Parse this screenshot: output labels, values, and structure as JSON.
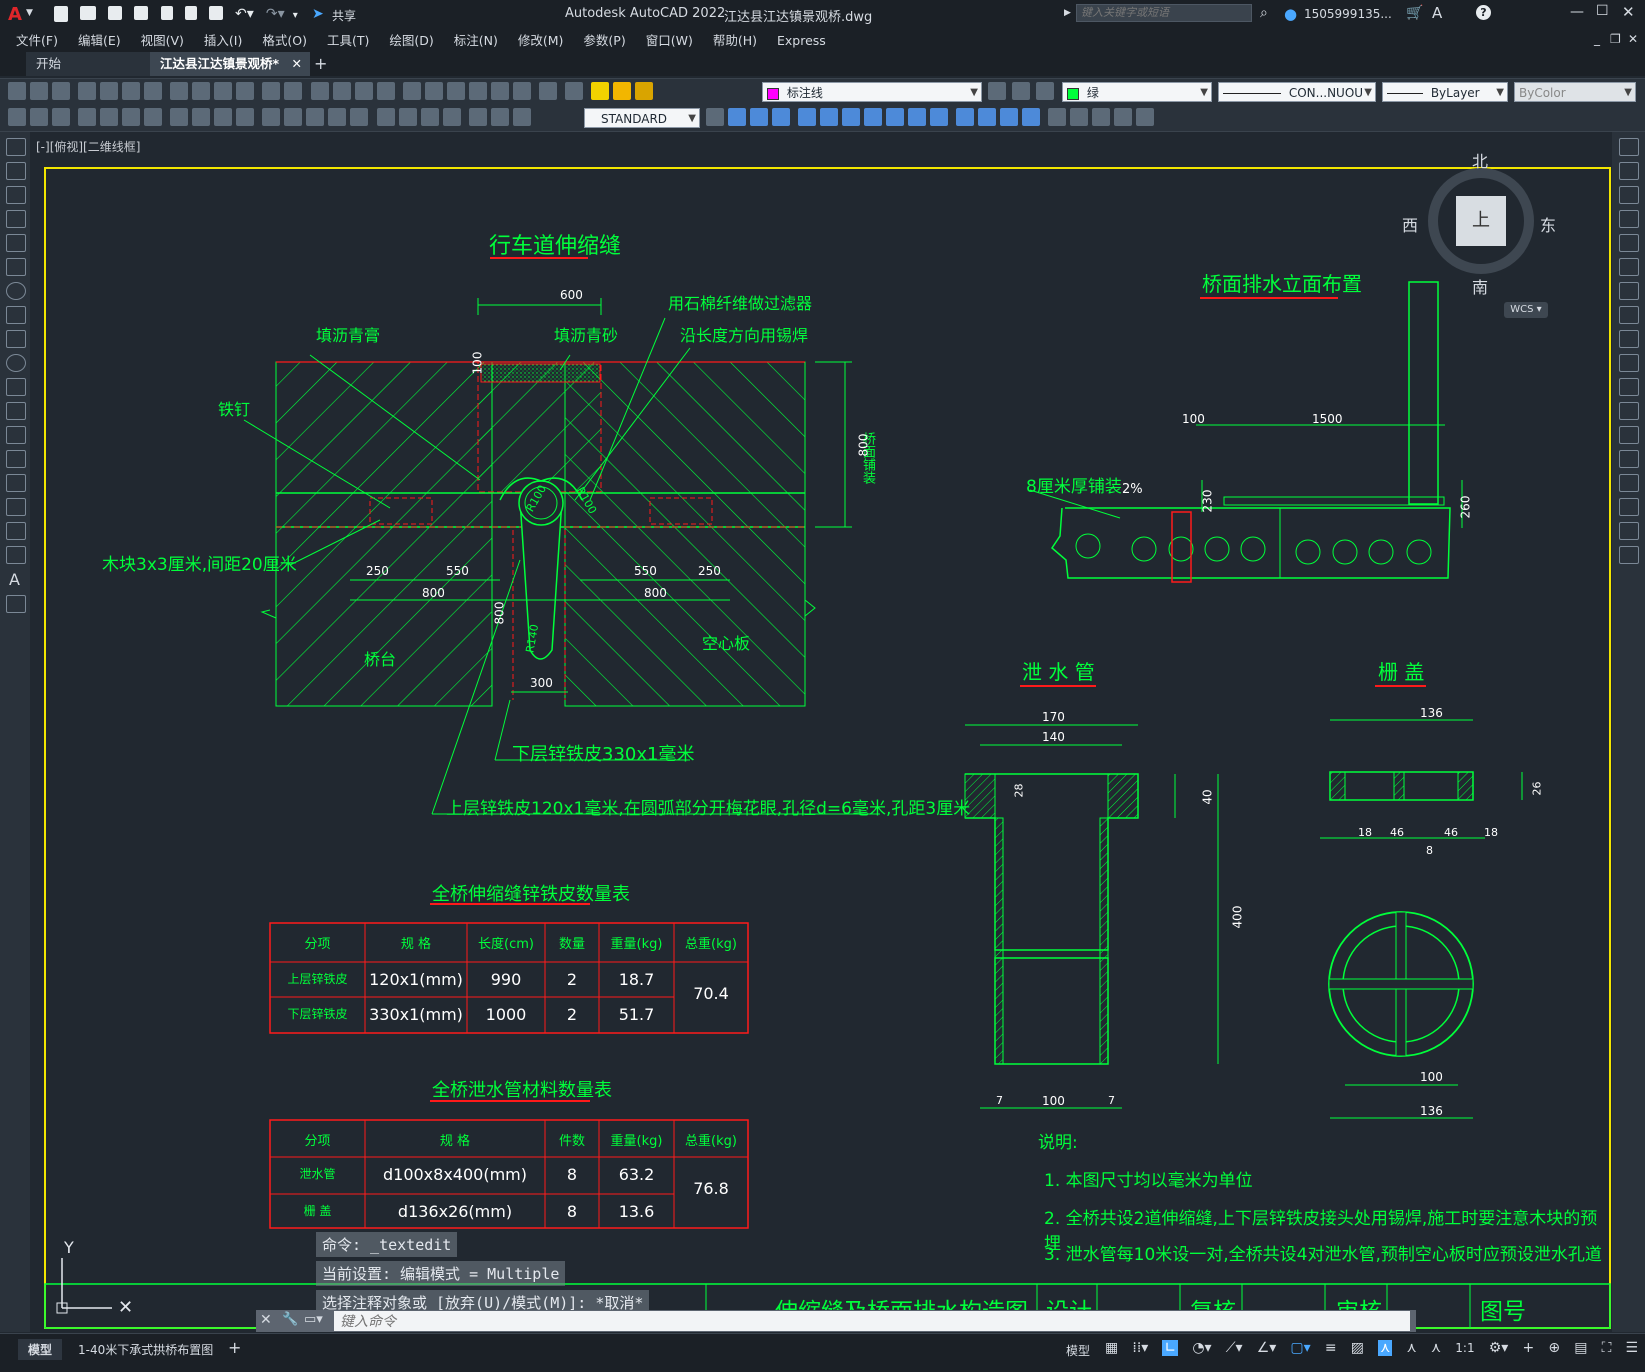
{
  "app": {
    "logo": "A",
    "title": "Autodesk AutoCAD 2022",
    "filename": "江达县江达镇景观桥.dwg",
    "share_label": "共享",
    "search_placeholder": "键入关键字或短语",
    "user": "1505999135...",
    "window_controls": [
      "minimize-icon",
      "maximize-icon",
      "close-icon"
    ]
  },
  "menu": [
    "文件(F)",
    "编辑(E)",
    "视图(V)",
    "插入(I)",
    "格式(O)",
    "工具(T)",
    "绘图(D)",
    "标注(N)",
    "修改(M)",
    "参数(P)",
    "窗口(W)",
    "帮助(H)",
    "Express"
  ],
  "tabs": [
    {
      "label": "开始",
      "active": false
    },
    {
      "label": "江达县江达镇景观桥*",
      "active": true
    }
  ],
  "toolbar": {
    "layer_value": "标注线",
    "color_value": "绿",
    "linetype_value": "CON...NUOU",
    "lineweight_value": "ByLayer",
    "plotstyle_value": "ByColor",
    "textstyle_value": "STANDARD"
  },
  "viewport_label": "[-][俯视][二维线框]",
  "viewcube": {
    "north": "北",
    "south": "南",
    "east": "东",
    "west": "西",
    "face": "上",
    "wcs": "WCS"
  },
  "drawing": {
    "joint_title": "行车道伸缩缝",
    "joint_labels": {
      "filter": "用石棉纤维做过滤器",
      "weld": "沿长度方向用锡焊",
      "asphalt": "填沥青膏",
      "sand": "填沥青砂",
      "nail": "铁钉",
      "wood": "木块3x3厘米,间距20厘米",
      "abutment": "桥台",
      "hollow_slab": "空心板",
      "lower_sheet": "下层锌铁皮330x1毫米",
      "upper_sheet": "上层锌铁皮120x1毫米,在圆弧部分开梅花眼,孔径d=6毫米,孔距3厘米",
      "paving": "桥面铺装",
      "r100a": "R100",
      "r100b": "R100",
      "r140": "R140",
      "dims": {
        "d600": "600",
        "d100": "100",
        "d800v": "800",
        "d250a": "250",
        "d550a": "550",
        "d800a": "800",
        "d550b": "550",
        "d250b": "250",
        "d800b": "800",
        "d800c": "800",
        "d300": "300"
      }
    },
    "drain_title": "桥面排水立面布置",
    "drain_labels": {
      "paving8": "8厘米厚铺装",
      "slope": "2%",
      "d100": "100",
      "d1500": "1500",
      "d230": "230",
      "d260": "260"
    },
    "pipe_title": "泄 水 管",
    "pipe_dims": {
      "d170": "170",
      "d140": "140",
      "d28": "28",
      "d40": "40",
      "d400": "400",
      "d100": "100",
      "d7a": "7",
      "d7b": "7"
    },
    "grate_title": "栅 盖",
    "grate_dims": {
      "d136a": "136",
      "d26": "26",
      "d18a": "18",
      "d46a": "46",
      "d46b": "46",
      "d18b": "18",
      "d8": "8",
      "d100": "100",
      "d136b": "136"
    },
    "table1": {
      "title": "全桥伸缩缝锌铁皮数量表",
      "headers": [
        "分项",
        "规 格",
        "长度(cm)",
        "数量",
        "重量(kg)",
        "总重(kg)"
      ],
      "rows": [
        [
          "上层锌铁皮",
          "120x1(mm)",
          "990",
          "2",
          "18.7"
        ],
        [
          "下层锌铁皮",
          "330x1(mm)",
          "1000",
          "2",
          "51.7"
        ]
      ],
      "total": "70.4"
    },
    "table2": {
      "title": "全桥泄水管材料数量表",
      "headers": [
        "分项",
        "规 格",
        "件数",
        "重量(kg)",
        "总重(kg)"
      ],
      "rows": [
        [
          "泄水管",
          "d100x8x400(mm)",
          "8",
          "63.2"
        ],
        [
          "栅 盖",
          "d136x26(mm)",
          "8",
          "13.6"
        ]
      ],
      "total": "76.8"
    },
    "notes": {
      "title": "说明:",
      "lines": [
        "1. 本图尺寸均以毫米为单位",
        "2. 全桥共设2道伸缩缝,上下层锌铁皮接头处用锡焊,施工时要注意木块的预埋",
        "3. 泄水管每10米设一对,全桥共设4对泄水管,预制空心板时应预设泄水孔道"
      ]
    },
    "title_block": [
      "伸缩缝及桥面排水构造图",
      "设计",
      "复核",
      "审核",
      "图号"
    ],
    "ucs": {
      "y": "Y"
    }
  },
  "command": {
    "history": [
      "命令: _textedit",
      "当前设置: 编辑模式 = Multiple",
      "选择注释对象或 [放弃(U)/模式(M)]: *取消*"
    ],
    "placeholder": "键入命令"
  },
  "status": {
    "layout_tabs": [
      "模型",
      "1-40米下承式拱桥布置图"
    ],
    "model_label": "模型",
    "scale": "1:1"
  },
  "colors": {
    "green": "#00ff3b",
    "red": "#ff1a1a",
    "yellow": "#f2e600",
    "white": "#ffffff",
    "magenta": "#ff00ff"
  }
}
